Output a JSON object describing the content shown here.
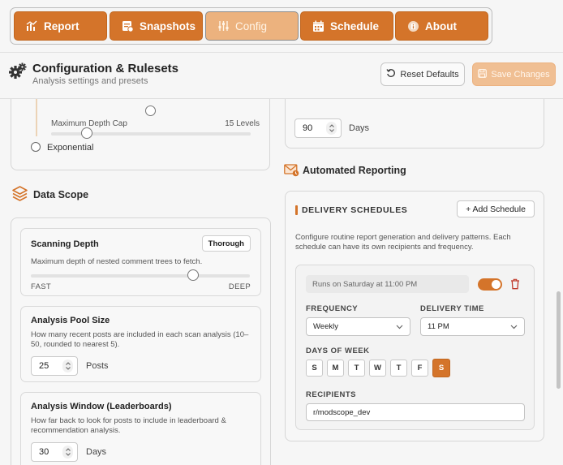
{
  "tabs": [
    {
      "label": "Report",
      "icon": "chart-bars-icon",
      "active": false
    },
    {
      "label": "Snapshots",
      "icon": "snapshot-icon",
      "active": false
    },
    {
      "label": "Config",
      "icon": "sliders-icon",
      "active": true
    },
    {
      "label": "Schedule",
      "icon": "calendar-icon",
      "active": false
    },
    {
      "label": "About",
      "icon": "info-book-icon",
      "active": false
    }
  ],
  "header": {
    "title": "Configuration & Rulesets",
    "subtitle": "Analysis settings and presets",
    "reset_label": "Reset Defaults",
    "save_label": "Save Changes"
  },
  "left": {
    "depth_cap": {
      "label": "Maximum Depth Cap",
      "value_text": "15 Levels",
      "level": 0.18
    },
    "exponential_label": "Exponential",
    "data_scope_title": "Data Scope",
    "scanning": {
      "title": "Scanning Depth",
      "badge": "Thorough",
      "desc": "Maximum depth of nested comment trees to fetch.",
      "min_label": "FAST",
      "max_label": "DEEP",
      "level": 0.74
    },
    "pool": {
      "title": "Analysis Pool Size",
      "desc": "How many recent posts are included in each scan analysis (10–50, rounded to nearest 5).",
      "value": "25",
      "unit": "Posts"
    },
    "window": {
      "title": "Analysis Window (Leaderboards)",
      "desc": "How far back to look for posts to include in leaderboard & recommendation analysis.",
      "value": "30",
      "unit": "Days"
    }
  },
  "right": {
    "retention": {
      "value": "90",
      "unit": "Days"
    },
    "automated_title": "Automated Reporting",
    "schedules": {
      "title": "DELIVERY SCHEDULES",
      "add_label": "+ Add Schedule",
      "desc": "Configure routine report generation and delivery patterns. Each schedule can have its own recipients and frequency.",
      "item": {
        "runs_text": "Runs on Saturday at 11:00 PM",
        "enabled": true,
        "frequency_label": "FREQUENCY",
        "frequency_value": "Weekly",
        "time_label": "DELIVERY TIME",
        "time_value": "11 PM",
        "days_label": "DAYS OF WEEK",
        "days": [
          {
            "letter": "S",
            "on": false
          },
          {
            "letter": "M",
            "on": false
          },
          {
            "letter": "T",
            "on": false
          },
          {
            "letter": "W",
            "on": false
          },
          {
            "letter": "T",
            "on": false
          },
          {
            "letter": "F",
            "on": false
          },
          {
            "letter": "S",
            "on": true
          }
        ],
        "recipients_label": "RECIPIENTS",
        "recipients_value": "r/modscope_dev"
      }
    }
  },
  "colors": {
    "accent": "#d4742a",
    "accent_light": "#ecb27e",
    "delete": "#c0392b"
  }
}
